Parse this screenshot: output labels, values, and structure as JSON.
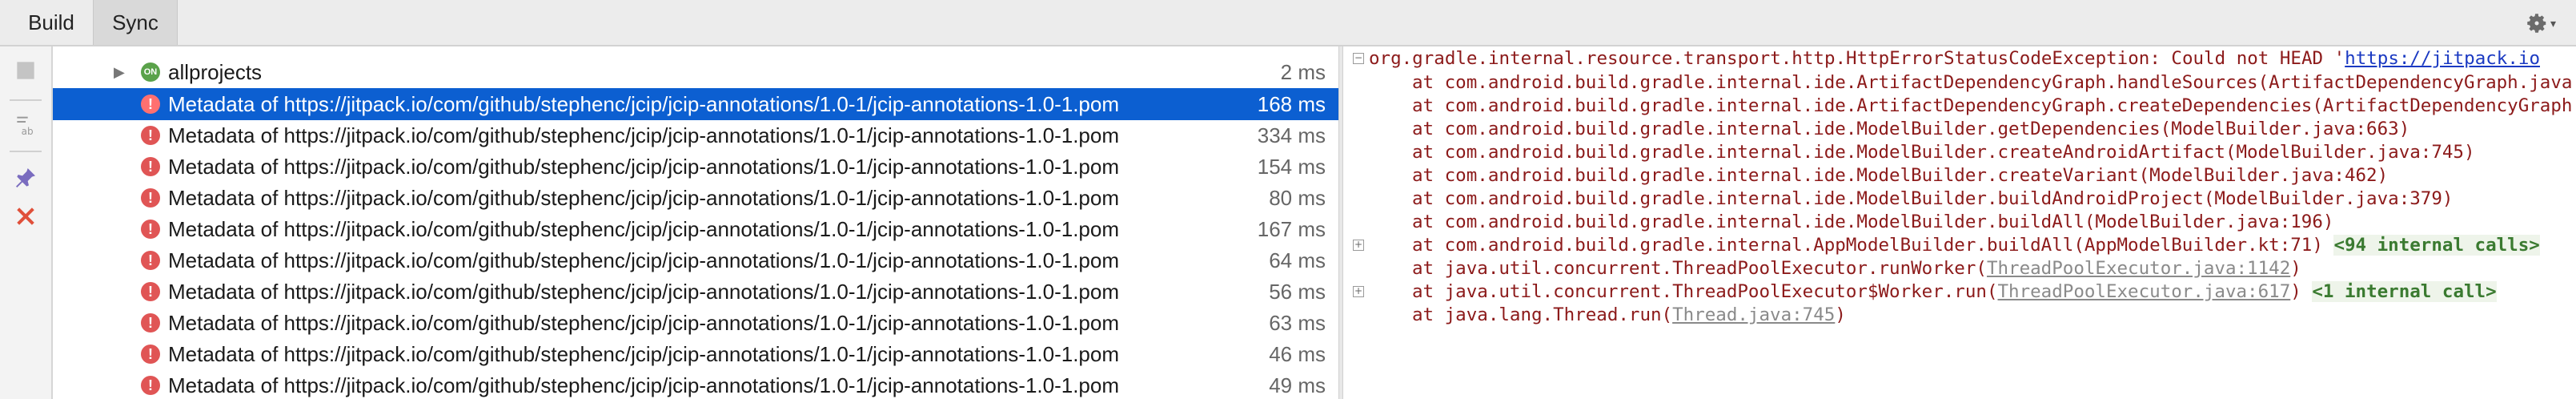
{
  "tabs": [
    {
      "label": "Build"
    },
    {
      "label": "Sync"
    }
  ],
  "tree": {
    "root": {
      "label": "allprojects",
      "time": "2 ms"
    },
    "items": [
      {
        "label": "Metadata of https://jitpack.io/com/github/stephenc/jcip/jcip-annotations/1.0-1/jcip-annotations-1.0-1.pom",
        "time": "168 ms",
        "selected": true
      },
      {
        "label": "Metadata of https://jitpack.io/com/github/stephenc/jcip/jcip-annotations/1.0-1/jcip-annotations-1.0-1.pom",
        "time": "334 ms"
      },
      {
        "label": "Metadata of https://jitpack.io/com/github/stephenc/jcip/jcip-annotations/1.0-1/jcip-annotations-1.0-1.pom",
        "time": "154 ms"
      },
      {
        "label": "Metadata of https://jitpack.io/com/github/stephenc/jcip/jcip-annotations/1.0-1/jcip-annotations-1.0-1.pom",
        "time": "80 ms"
      },
      {
        "label": "Metadata of https://jitpack.io/com/github/stephenc/jcip/jcip-annotations/1.0-1/jcip-annotations-1.0-1.pom",
        "time": "167 ms"
      },
      {
        "label": "Metadata of https://jitpack.io/com/github/stephenc/jcip/jcip-annotations/1.0-1/jcip-annotations-1.0-1.pom",
        "time": "64 ms"
      },
      {
        "label": "Metadata of https://jitpack.io/com/github/stephenc/jcip/jcip-annotations/1.0-1/jcip-annotations-1.0-1.pom",
        "time": "56 ms"
      },
      {
        "label": "Metadata of https://jitpack.io/com/github/stephenc/jcip/jcip-annotations/1.0-1/jcip-annotations-1.0-1.pom",
        "time": "63 ms"
      },
      {
        "label": "Metadata of https://jitpack.io/com/github/stephenc/jcip/jcip-annotations/1.0-1/jcip-annotations-1.0-1.pom",
        "time": "46 ms"
      },
      {
        "label": "Metadata of https://jitpack.io/com/github/stephenc/jcip/jcip-annotations/1.0-1/jcip-annotations-1.0-1.pom",
        "time": "49 ms"
      }
    ]
  },
  "console": {
    "exception": "org.gradle.internal.resource.transport.http.HttpErrorStatusCodeException: Could not HEAD '",
    "exception_link": "https://jitpack.io",
    "frames": [
      {
        "text": "at com.android.build.gradle.internal.ide.ArtifactDependencyGraph.handleSources(ArtifactDependencyGraph.java"
      },
      {
        "text": "at com.android.build.gradle.internal.ide.ArtifactDependencyGraph.createDependencies(ArtifactDependencyGraph"
      },
      {
        "text": "at com.android.build.gradle.internal.ide.ModelBuilder.getDependencies(ModelBuilder.java:663)"
      },
      {
        "text": "at com.android.build.gradle.internal.ide.ModelBuilder.createAndroidArtifact(ModelBuilder.java:745)"
      },
      {
        "text": "at com.android.build.gradle.internal.ide.ModelBuilder.createVariant(ModelBuilder.java:462)"
      },
      {
        "text": "at com.android.build.gradle.internal.ide.ModelBuilder.buildAndroidProject(ModelBuilder.java:379)"
      },
      {
        "text": "at com.android.build.gradle.internal.ide.ModelBuilder.buildAll(ModelBuilder.java:196)"
      },
      {
        "text": "at com.android.build.gradle.internal.AppModelBuilder.buildAll(AppModelBuilder.kt:71) ",
        "internal": "<94 internal calls>"
      },
      {
        "text": "at java.util.concurrent.ThreadPoolExecutor.runWorker(",
        "link": "ThreadPoolExecutor.java:1142",
        "tail": ")"
      },
      {
        "text": "at java.util.concurrent.ThreadPoolExecutor$Worker.run(",
        "link": "ThreadPoolExecutor.java:617",
        "tail": ") ",
        "internal": "<1 internal call>"
      },
      {
        "text": "at java.lang.Thread.run(",
        "link": "Thread.java:745",
        "tail": ")"
      }
    ]
  },
  "icons": {
    "gear": "gear-icon",
    "stop": "stop-icon",
    "filter": "filter-icon",
    "pin": "pin-icon",
    "close": "close-icon"
  },
  "colors": {
    "selection": "#0c5fd1",
    "error": "#e05555",
    "console_text": "#8c1a1a",
    "link": "#1a39c2"
  }
}
